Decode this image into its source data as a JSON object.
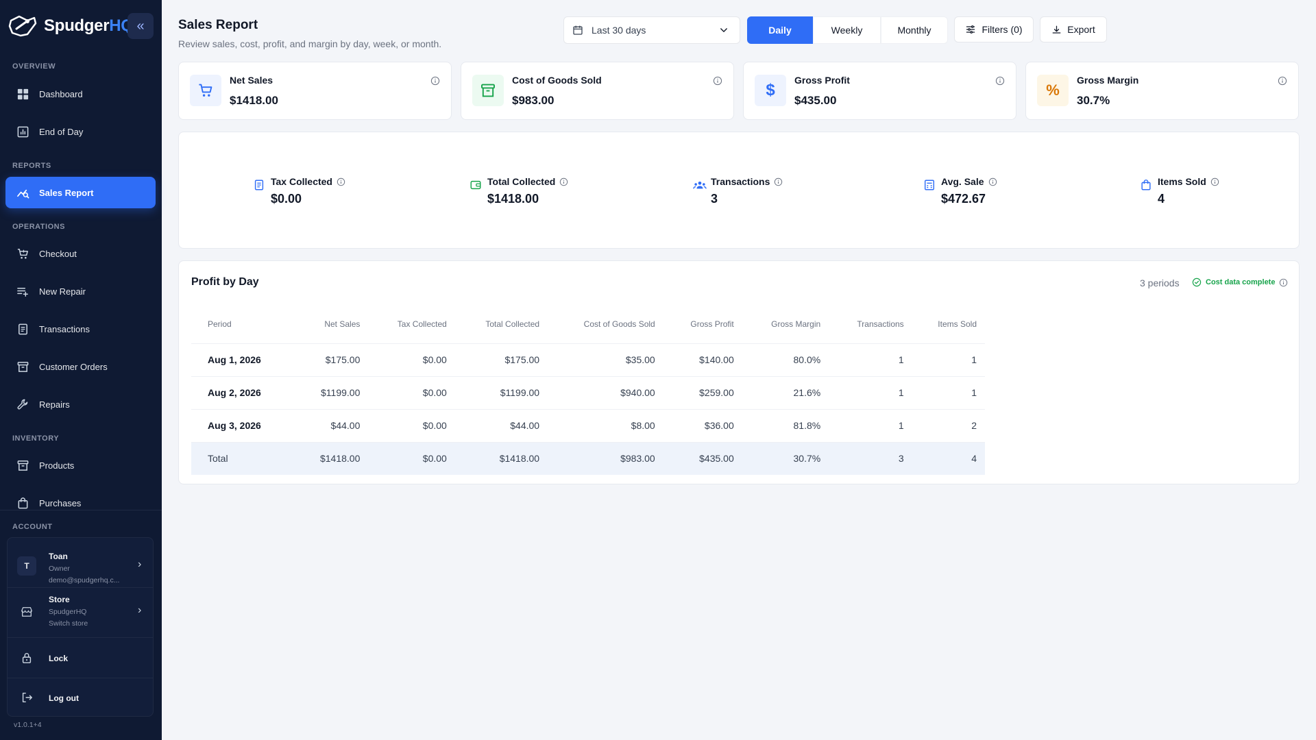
{
  "brand": {
    "name_main": "Spudger",
    "name_accent": "HQ"
  },
  "sidebar": {
    "sections": {
      "overview": "OVERVIEW",
      "reports": "REPORTS",
      "operations": "OPERATIONS",
      "inventory": "INVENTORY",
      "account": "ACCOUNT"
    },
    "items": {
      "dashboard": "Dashboard",
      "end_of_day": "End of Day",
      "sales_report": "Sales Report",
      "checkout": "Checkout",
      "new_repair": "New Repair",
      "transactions": "Transactions",
      "customer_orders": "Customer Orders",
      "repairs": "Repairs",
      "products": "Products",
      "purchases": "Purchases"
    },
    "account": {
      "user_initial": "T",
      "user_name": "Toan",
      "user_role": "Owner",
      "user_email": "demo@spudgerhq.c...",
      "store_title": "Store",
      "store_name": "SpudgerHQ",
      "store_action": "Switch store",
      "lock": "Lock",
      "logout": "Log out"
    },
    "version": "v1.0.1+4"
  },
  "header": {
    "title": "Sales Report",
    "subtitle": "Review sales, cost, profit, and margin by day, week, or month.",
    "date_range": "Last 30 days",
    "granularity": [
      "Daily",
      "Weekly",
      "Monthly"
    ],
    "granularity_selected": "Daily",
    "filters": "Filters (0)",
    "export": "Export"
  },
  "kpis": [
    {
      "label": "Net Sales",
      "value": "$1418.00",
      "icon": "cart-icon",
      "color": "#2f6df6",
      "bg": "#eef3fe"
    },
    {
      "label": "Cost of Goods Sold",
      "value": "$983.00",
      "icon": "archive-icon",
      "color": "#16a34a",
      "bg": "#ecfaf1"
    },
    {
      "label": "Gross Profit",
      "value": "$435.00",
      "icon": "dollar-icon",
      "color": "#2f6df6",
      "bg": "#eef3fe"
    },
    {
      "label": "Gross Margin",
      "value": "30.7%",
      "icon": "percent-icon",
      "color": "#d97706",
      "bg": "#fdf6e6"
    }
  ],
  "stats": [
    {
      "label": "Tax Collected",
      "value": "$0.00",
      "icon": "receipt-icon",
      "color": "#2f6df6"
    },
    {
      "label": "Total Collected",
      "value": "$1418.00",
      "icon": "wallet-icon",
      "color": "#16a34a"
    },
    {
      "label": "Transactions",
      "value": "3",
      "icon": "users-icon",
      "color": "#2f6df6"
    },
    {
      "label": "Avg. Sale",
      "value": "$472.67",
      "icon": "calculator-icon",
      "color": "#2f6df6"
    },
    {
      "label": "Items Sold",
      "value": "4",
      "icon": "bag-icon",
      "color": "#2f6df6"
    }
  ],
  "profit_table": {
    "title": "Profit by Day",
    "periods": "3 periods",
    "status": "Cost data complete",
    "columns": [
      "Period",
      "Net Sales",
      "Tax Collected",
      "Total Collected",
      "Cost of Goods Sold",
      "Gross Profit",
      "Gross Margin",
      "Transactions",
      "Items Sold"
    ],
    "rows": [
      [
        "Aug 1, 2026",
        "$175.00",
        "$0.00",
        "$175.00",
        "$35.00",
        "$140.00",
        "80.0%",
        "1",
        "1"
      ],
      [
        "Aug 2, 2026",
        "$1199.00",
        "$0.00",
        "$1199.00",
        "$940.00",
        "$259.00",
        "21.6%",
        "1",
        "1"
      ],
      [
        "Aug 3, 2026",
        "$44.00",
        "$0.00",
        "$44.00",
        "$8.00",
        "$36.00",
        "81.8%",
        "1",
        "2"
      ]
    ],
    "total": [
      "Total",
      "$1418.00",
      "$0.00",
      "$1418.00",
      "$983.00",
      "$435.00",
      "30.7%",
      "3",
      "4"
    ]
  }
}
